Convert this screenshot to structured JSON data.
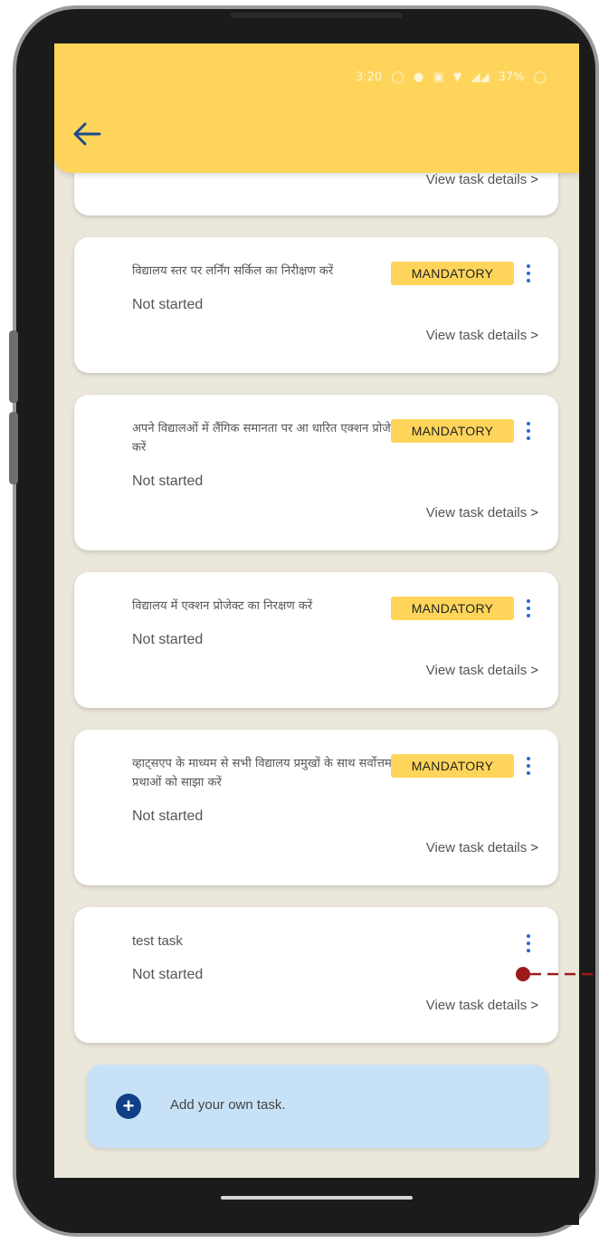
{
  "status_bar": {
    "time": "3:20",
    "battery": "37%"
  },
  "partial_card": {
    "view_details": "View task details"
  },
  "tasks": [
    {
      "title": "विद्यालय स्तर पर लर्निंग सर्किल का निरीक्षण करें",
      "status": "Not started",
      "badge": "MANDATORY",
      "view_details": "View task details"
    },
    {
      "title": "अपने विद्यालओं में लैंगिक समानता पर आ धारित एक्शन प्रोजेक्ट करें",
      "status": "Not started",
      "badge": "MANDATORY",
      "view_details": "View task details"
    },
    {
      "title": "विद्यालय में एक्शन प्रोजेक्ट का निरक्षण करें",
      "status": "Not started",
      "badge": "MANDATORY",
      "view_details": "View task details"
    },
    {
      "title": "व्हाट्सएप के माध्यम से सभी विद्यालय प्रमुखों के साथ सर्वोत्तम प्रथाओं को साझा करें",
      "status": "Not started",
      "badge": "MANDATORY",
      "view_details": "View task details"
    },
    {
      "title": "test task",
      "status": "Not started",
      "badge": "",
      "view_details": "View task details"
    }
  ],
  "add_task": {
    "label": "Add your own task."
  },
  "icons": {
    "back": "back-arrow-icon",
    "menu": "kebab-menu-icon",
    "chevron": "chevron-right-icon",
    "add": "plus-icon"
  },
  "colors": {
    "app_bar": "#fed55a",
    "badge": "#fed55a",
    "background": "#ebe7da",
    "add_task_bg": "#c7e2f6",
    "add_icon": "#103f86",
    "kebab": "#2f66c4",
    "pointer": "#9b1b1b"
  }
}
